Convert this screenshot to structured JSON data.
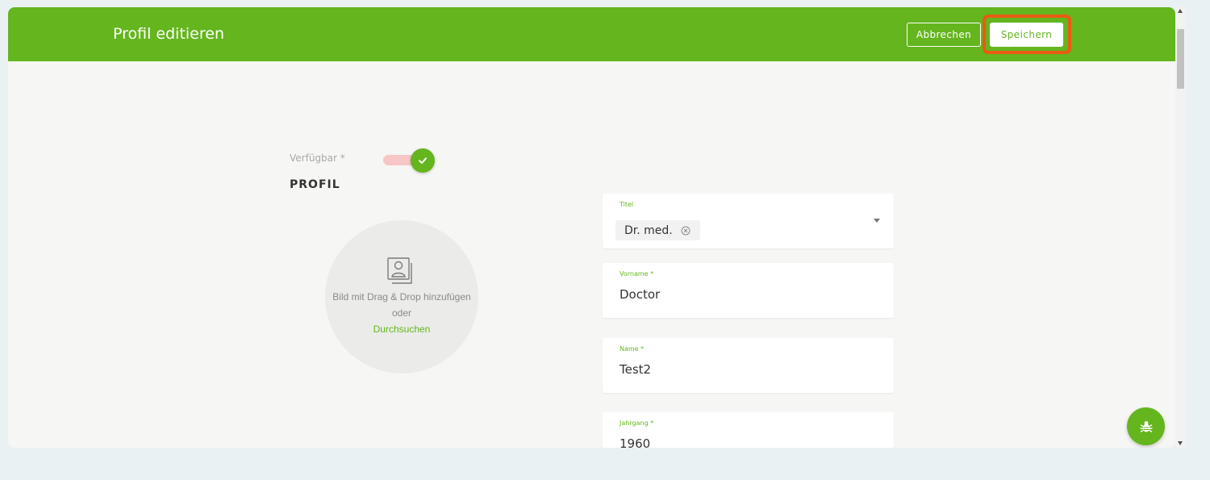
{
  "header": {
    "title": "Profil editieren",
    "cancel_label": "Abbrechen",
    "save_label": "Speichern"
  },
  "availability": {
    "label": "Verfügbar *",
    "enabled": true
  },
  "profile": {
    "section_title": "PROFIL",
    "upload": {
      "line1": "Bild mit Drag & Drop hinzufügen",
      "line2": "oder",
      "browse_link": "Durchsuchen"
    }
  },
  "fields": {
    "title": {
      "label": "Titel",
      "chip": "Dr. med."
    },
    "firstname": {
      "label": "Vorname *",
      "value": "Doctor"
    },
    "name": {
      "label": "Name *",
      "value": "Test2"
    },
    "year": {
      "label": "Jahrgang *",
      "value": "1960"
    }
  },
  "colors": {
    "brand": "#64b51e",
    "highlight": "#ea5a12",
    "toggle_track": "#f7c6c7"
  },
  "icons": {
    "toggle": "check-icon",
    "avatar": "image-placeholder-icon",
    "chip_remove": "close-circle-icon",
    "dropdown": "chevron-down-icon",
    "bug_report": "bug-icon"
  }
}
